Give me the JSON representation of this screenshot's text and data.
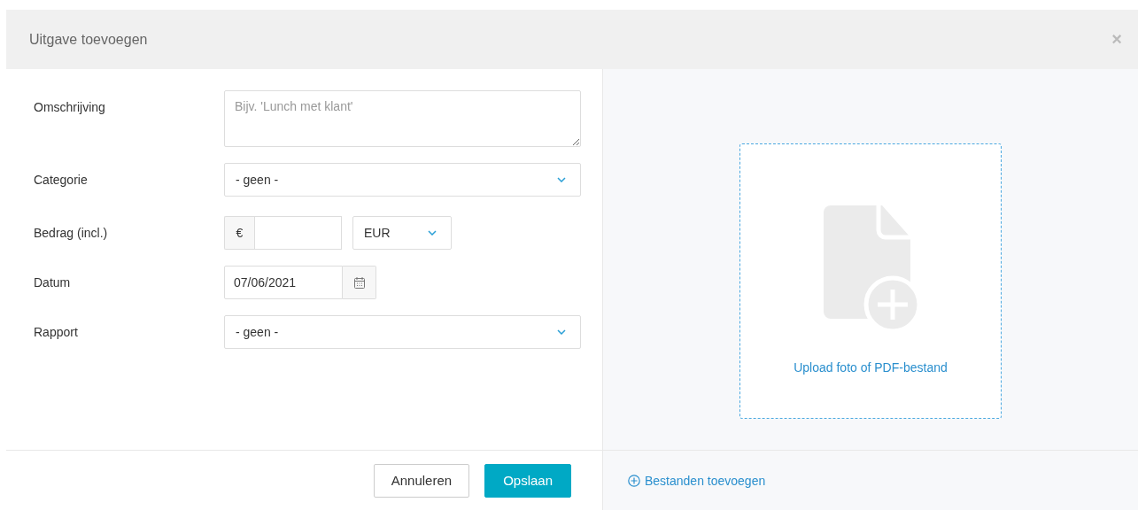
{
  "dialog": {
    "title": "Uitgave toevoegen",
    "close": "×"
  },
  "fields": [
    {
      "kind": "textarea",
      "label": "Omschrijving",
      "placeholder": "Bijv. 'Lunch met klant'"
    },
    {
      "kind": "select",
      "label": "Categorie",
      "value": "- geen -"
    },
    {
      "kind": "amount",
      "label": "Bedrag (incl.)",
      "prefix": "€",
      "currency": "EUR"
    },
    {
      "kind": "date",
      "label": "Datum",
      "value": "07/06/2021"
    },
    {
      "kind": "select",
      "label": "Rapport",
      "value": "- geen -"
    }
  ],
  "buttons": [
    {
      "label": "Annuleren",
      "kind": "secondary"
    },
    {
      "label": "Opslaan",
      "kind": "primary"
    }
  ],
  "upload": {
    "text": "Upload foto of PDF-bestand",
    "add_link": "Bestanden toevoegen"
  }
}
